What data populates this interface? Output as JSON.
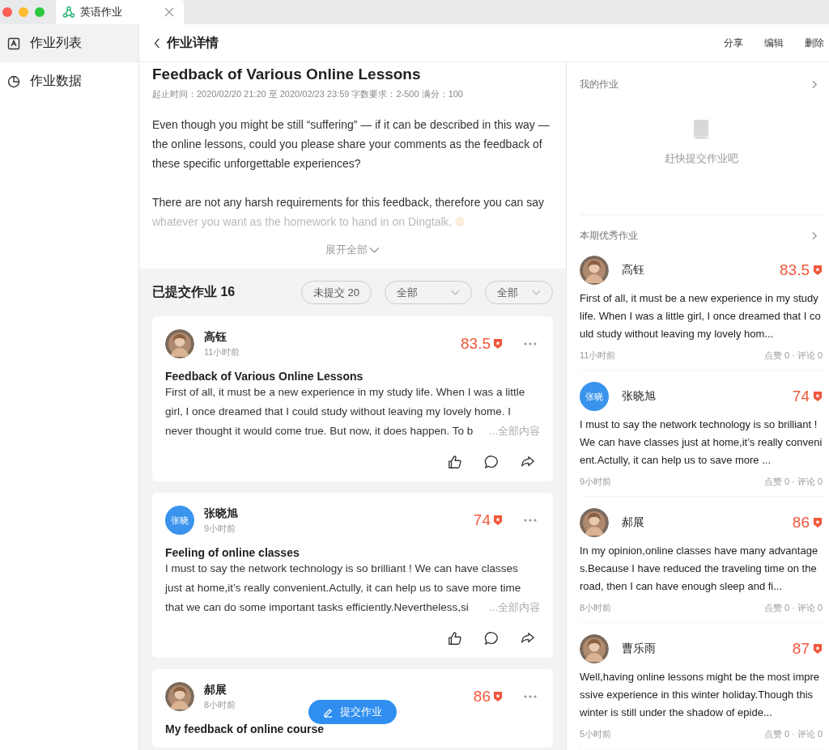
{
  "window": {
    "tab_title": "英语作业"
  },
  "sidebar": {
    "items": [
      {
        "label": "作业列表",
        "selected": true
      },
      {
        "label": "作业数据",
        "selected": false
      }
    ]
  },
  "header": {
    "back_label": "作业详情",
    "actions": [
      "分享",
      "编辑",
      "删除"
    ]
  },
  "assignment": {
    "title": "Feedback of Various Online Lessons",
    "meta": "起止时间：2020/02/20 21:20 至 2020/02/23 23:59 字数要求：2-500 满分：100",
    "paragraphs": [
      {
        "text": "Even though you might be still “suffering” — if it can be described in this way — the online lessons, could you please share your comments as the feedback of these specific unforgettable experiences?",
        "faded": false
      },
      {
        "text": "There are not any harsh requirements for this feedback, therefore you can say whatever you want as the homework to hand in on Dingtalk.",
        "faded": true
      }
    ],
    "expand": "展开全部"
  },
  "submissions": {
    "heading": "已提交作业 16",
    "filters": [
      {
        "label": "未提交 20",
        "kind": "button"
      },
      {
        "label": "全部",
        "kind": "dropdown"
      },
      {
        "label": "全部",
        "kind": "dropdown"
      }
    ],
    "items": [
      {
        "name": "高钰",
        "time": "11小时前",
        "score": "83.5",
        "avatar": {
          "kind": "picture"
        },
        "title": "Feedback of Various Online Lessons",
        "body": [
          "First of all, it must be a new experience in my study life. When I was a little",
          "girl, I once dreamed that I could study without leaving my lovely home. I",
          "never thought it would come true. But now, it does happen. To b"
        ],
        "more": "...全部内容"
      },
      {
        "name": "张晓旭",
        "time": "9小时前",
        "score": "74",
        "avatar": {
          "kind": "initials",
          "text": "张晓"
        },
        "title": "Feeling of online classes",
        "body": [
          "I must to say the network technology is so brilliant ! We can have classes",
          "just at home,it’s really convenient.Actully, it can help us to save more time",
          "that we can do some important tasks efficiently.Nevertheless,si"
        ],
        "more": "...全部内容"
      },
      {
        "name": "郝展",
        "time": "8小时前",
        "score": "86",
        "avatar": {
          "kind": "picture"
        },
        "title": "My feedback of online course"
      }
    ]
  },
  "fab": {
    "label": "提交作业"
  },
  "my_work": {
    "title": "我的作业",
    "empty_text": "赶快提交作业吧"
  },
  "excellent": {
    "title": "本期优秀作业",
    "items": [
      {
        "name": "高钰",
        "score": "83.5",
        "avatar": {
          "kind": "picture"
        },
        "body": "First of all, it must be a new experience in my study life. When I was a little girl, I once dreamed that I could study without leaving my lovely hom...",
        "time": "11小时前",
        "stats": "点赞 0 · 评论 0"
      },
      {
        "name": "张晓旭",
        "score": "74",
        "avatar": {
          "kind": "initials",
          "text": "张晓"
        },
        "body": "I must to say the network technology is so brilliant ! We can have classes just at home,it’s really convenient.Actully, it can help us to save more ...",
        "time": "9小时前",
        "stats": "点赞 0 · 评论 0"
      },
      {
        "name": "郝展",
        "score": "86",
        "avatar": {
          "kind": "picture"
        },
        "body": "In my opinion,online classes have many advantages.Because I have reduced the traveling time on the road, then I can have enough sleep and fi...",
        "time": "8小时前",
        "stats": "点赞 0 · 评论 0"
      },
      {
        "name": "曹乐雨",
        "score": "87",
        "avatar": {
          "kind": "picture"
        },
        "body": "Well,having online lessons might be the most impressive experience in this winter holiday.Though this winter is still under the shadow of epide...",
        "time": "5小时前",
        "stats": "点赞 0 · 评论 0"
      }
    ]
  }
}
